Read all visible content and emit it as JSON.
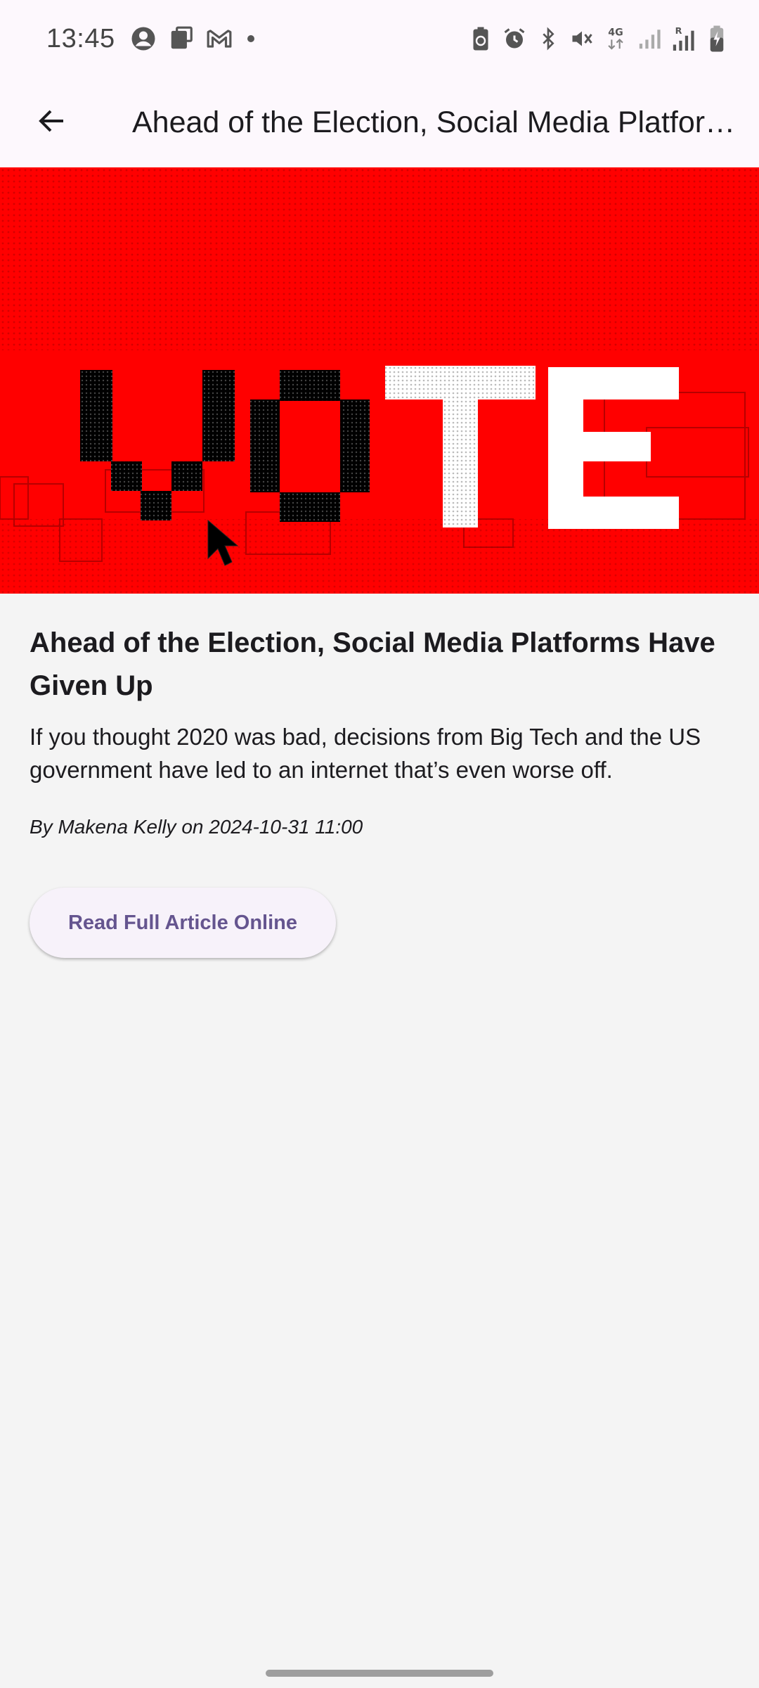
{
  "status_bar": {
    "time": "13:45",
    "left_icons": [
      "account-icon",
      "cast-icon",
      "gmail-icon",
      "dot-icon"
    ],
    "right_icons": [
      "battery-saver-icon",
      "alarm-icon",
      "bluetooth-icon",
      "mute-icon",
      "network-4g-icon",
      "signal-icon",
      "signal-roaming-icon",
      "battery-icon"
    ],
    "network_label": "4G",
    "roaming_label": "R"
  },
  "app_bar": {
    "back_icon": "arrow-back-icon",
    "title": "Ahead of the Election, Social Media Platforms Have Given Up"
  },
  "hero": {
    "image_text": "VOTE",
    "accent_color": "#ff0000"
  },
  "article": {
    "headline": "Ahead of the Election, Social Media Platforms Have Given Up",
    "summary": "If you thought 2020 was bad, decisions from Big Tech and the US government have led to an internet that’s even worse off.",
    "byline": "By Makena Kelly on 2024-10-31 11:00"
  },
  "actions": {
    "read_full_label": "Read Full Article Online",
    "button_text_color": "#65558f"
  }
}
